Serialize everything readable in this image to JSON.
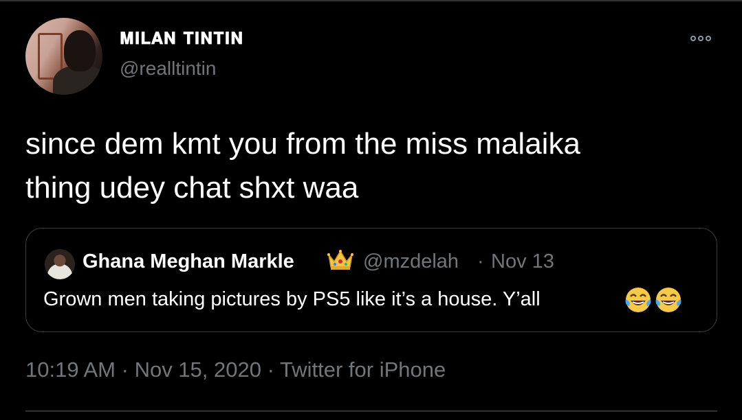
{
  "tweet": {
    "display_name": "𝐌𝐈𝐋𝐀𝐍 𝐓𝐈𝐍𝐓𝐈𝐍",
    "handle": "@realltintin",
    "text": "since dem kmt you from the miss malaika\nthing udey chat shxt waa",
    "time": "10:19 AM",
    "separator": "·",
    "date": "Nov 15, 2020",
    "source": "Twitter for iPhone",
    "more_icon": "more-options-icon"
  },
  "quoted_tweet": {
    "display_name": "Ghana Meghan Markle",
    "badge_icon": "crown-emoji",
    "handle": "@mzdelah",
    "separator": "·",
    "date": "Nov 13",
    "text": "Grown men taking pictures by PS5 like it’s a house. Y’all",
    "trailing_icons": [
      "laughing-tears-emoji",
      "laughing-tears-emoji"
    ]
  },
  "colors": {
    "background": "#000000",
    "primary_text": "#ffffff",
    "secondary_text": "#71767b",
    "border": "#3a3f44"
  }
}
